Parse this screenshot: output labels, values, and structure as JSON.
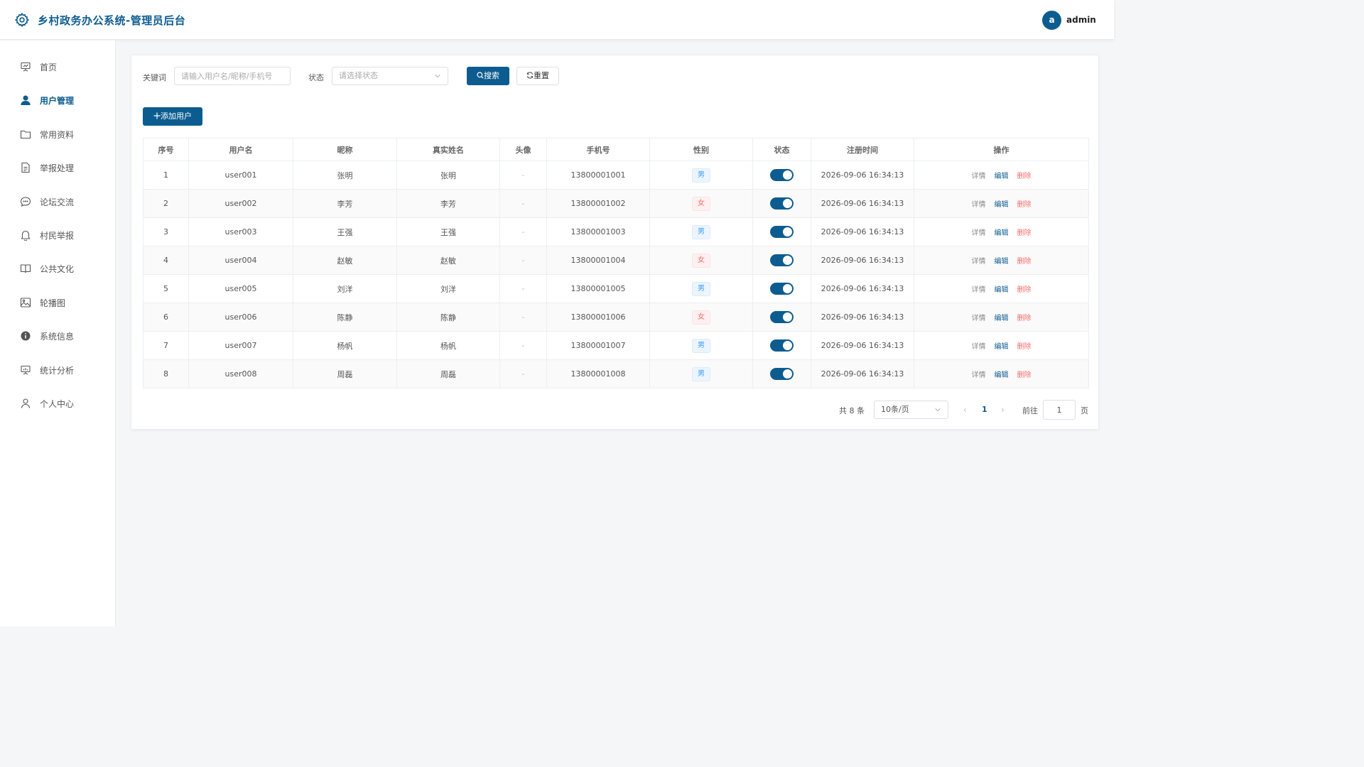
{
  "header": {
    "title": "乡村政务办公系统-管理员后台",
    "avatar_letter": "a",
    "username": "admin"
  },
  "sidebar": {
    "items": [
      {
        "label": "首页",
        "icon": "presentation-icon"
      },
      {
        "label": "用户管理",
        "icon": "user-filled-icon",
        "active": true
      },
      {
        "label": "常用资料",
        "icon": "folder-icon"
      },
      {
        "label": "举报处理",
        "icon": "document-icon"
      },
      {
        "label": "论坛交流",
        "icon": "chat-bubble-icon"
      },
      {
        "label": "村民举报",
        "icon": "bell-icon"
      },
      {
        "label": "公共文化",
        "icon": "book-icon"
      },
      {
        "label": "轮播图",
        "icon": "picture-icon"
      },
      {
        "label": "系统信息",
        "icon": "info-icon"
      },
      {
        "label": "统计分析",
        "icon": "chart-board-icon"
      },
      {
        "label": "个人中心",
        "icon": "user-outline-icon"
      }
    ]
  },
  "search": {
    "keyword_label": "关键词",
    "keyword_placeholder": "请输入用户名/昵称/手机号",
    "status_label": "状态",
    "status_placeholder": "请选择状态",
    "search_button": "搜索",
    "reset_button": "重置"
  },
  "add_button": "添加用户",
  "table": {
    "headers": [
      "序号",
      "用户名",
      "昵称",
      "真实姓名",
      "头像",
      "手机号",
      "性别",
      "状态",
      "注册时间",
      "操作"
    ],
    "rows": [
      {
        "no": "1",
        "username": "user001",
        "nickname": "张明",
        "realname": "张明",
        "avatar": "-",
        "phone": "13800001001",
        "gender": "男",
        "status": true,
        "time": "2026-09-06 16:34:13"
      },
      {
        "no": "2",
        "username": "user002",
        "nickname": "李芳",
        "realname": "李芳",
        "avatar": "-",
        "phone": "13800001002",
        "gender": "女",
        "status": true,
        "time": "2026-09-06 16:34:13"
      },
      {
        "no": "3",
        "username": "user003",
        "nickname": "王强",
        "realname": "王强",
        "avatar": "-",
        "phone": "13800001003",
        "gender": "男",
        "status": true,
        "time": "2026-09-06 16:34:13"
      },
      {
        "no": "4",
        "username": "user004",
        "nickname": "赵敏",
        "realname": "赵敏",
        "avatar": "-",
        "phone": "13800001004",
        "gender": "女",
        "status": true,
        "time": "2026-09-06 16:34:13"
      },
      {
        "no": "5",
        "username": "user005",
        "nickname": "刘洋",
        "realname": "刘洋",
        "avatar": "-",
        "phone": "13800001005",
        "gender": "男",
        "status": true,
        "time": "2026-09-06 16:34:13"
      },
      {
        "no": "6",
        "username": "user006",
        "nickname": "陈静",
        "realname": "陈静",
        "avatar": "-",
        "phone": "13800001006",
        "gender": "女",
        "status": true,
        "time": "2026-09-06 16:34:13"
      },
      {
        "no": "7",
        "username": "user007",
        "nickname": "杨帆",
        "realname": "杨帆",
        "avatar": "-",
        "phone": "13800001007",
        "gender": "男",
        "status": true,
        "time": "2026-09-06 16:34:13"
      },
      {
        "no": "8",
        "username": "user008",
        "nickname": "周磊",
        "realname": "周磊",
        "avatar": "-",
        "phone": "13800001008",
        "gender": "男",
        "status": true,
        "time": "2026-09-06 16:34:13"
      }
    ],
    "actions": {
      "detail": "详情",
      "edit": "编辑",
      "delete": "删除"
    }
  },
  "pagination": {
    "total": "共 8 条",
    "page_size": "10条/页",
    "current_page": "1",
    "goto_label": "前往",
    "goto_value": "1",
    "goto_unit": "页"
  },
  "colors": {
    "primary": "#0d5c8f",
    "male_tag": "#409eff",
    "female_tag": "#f56c6c"
  }
}
